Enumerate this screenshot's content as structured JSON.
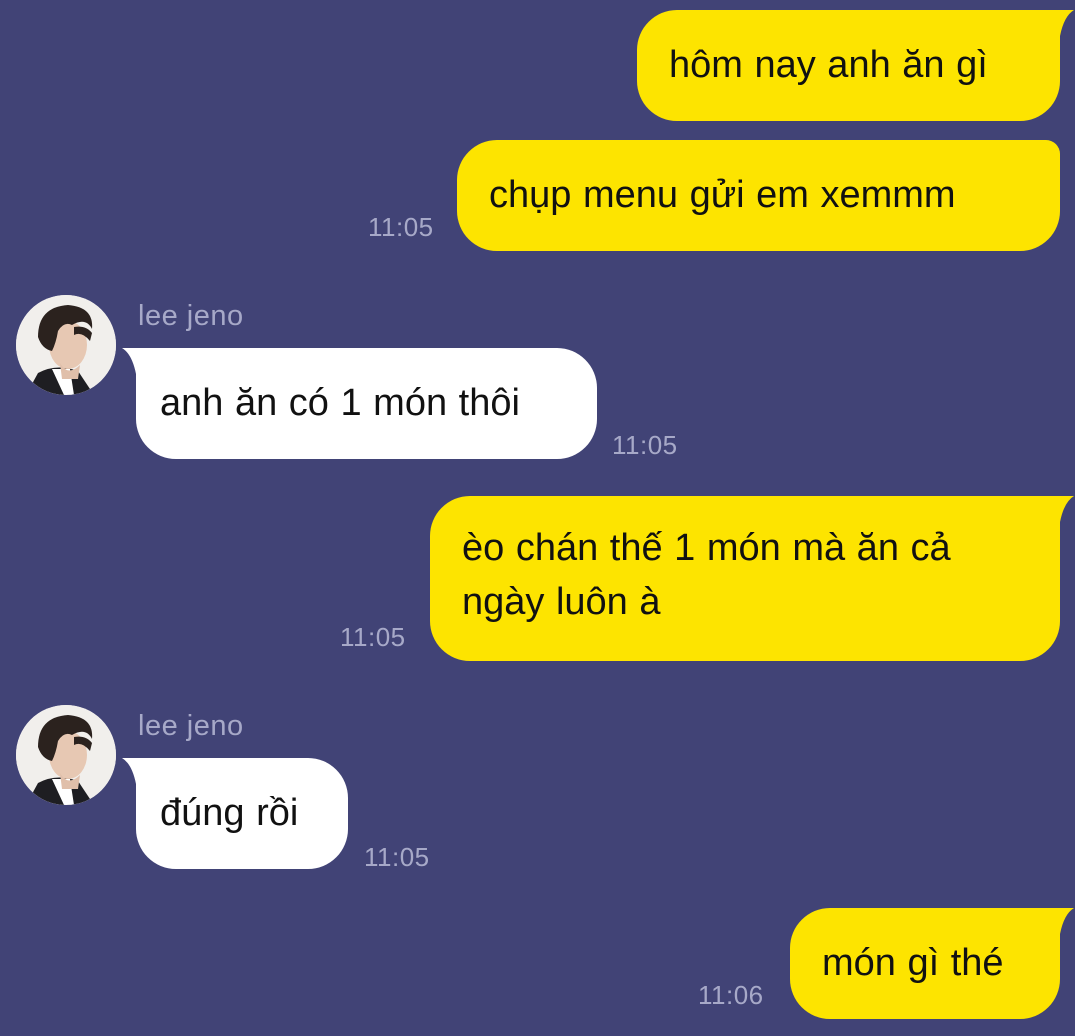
{
  "colors": {
    "background": "#414376",
    "outgoing_bubble": "#FDE400",
    "incoming_bubble": "#FFFFFF",
    "timestamp_text": "#A7A9C8",
    "message_text": "#111111"
  },
  "messages": [
    {
      "direction": "outgoing",
      "text": "hôm nay anh ăn gì",
      "time": ""
    },
    {
      "direction": "outgoing",
      "text": "chụp menu gửi em xemmm",
      "time": "11:05"
    },
    {
      "direction": "incoming",
      "sender": "lee jeno",
      "avatar_icon": "user-avatar-icon",
      "text": "anh ăn có 1 món thôi",
      "time": "11:05"
    },
    {
      "direction": "outgoing",
      "text": "èo chán thế 1 món mà ăn cả ngày luôn à",
      "time": "11:05"
    },
    {
      "direction": "incoming",
      "sender": "lee jeno",
      "avatar_icon": "user-avatar-icon",
      "text": "đúng rồi",
      "time": "11:05"
    },
    {
      "direction": "outgoing",
      "text": "món gì thé",
      "time": "11:06"
    }
  ]
}
